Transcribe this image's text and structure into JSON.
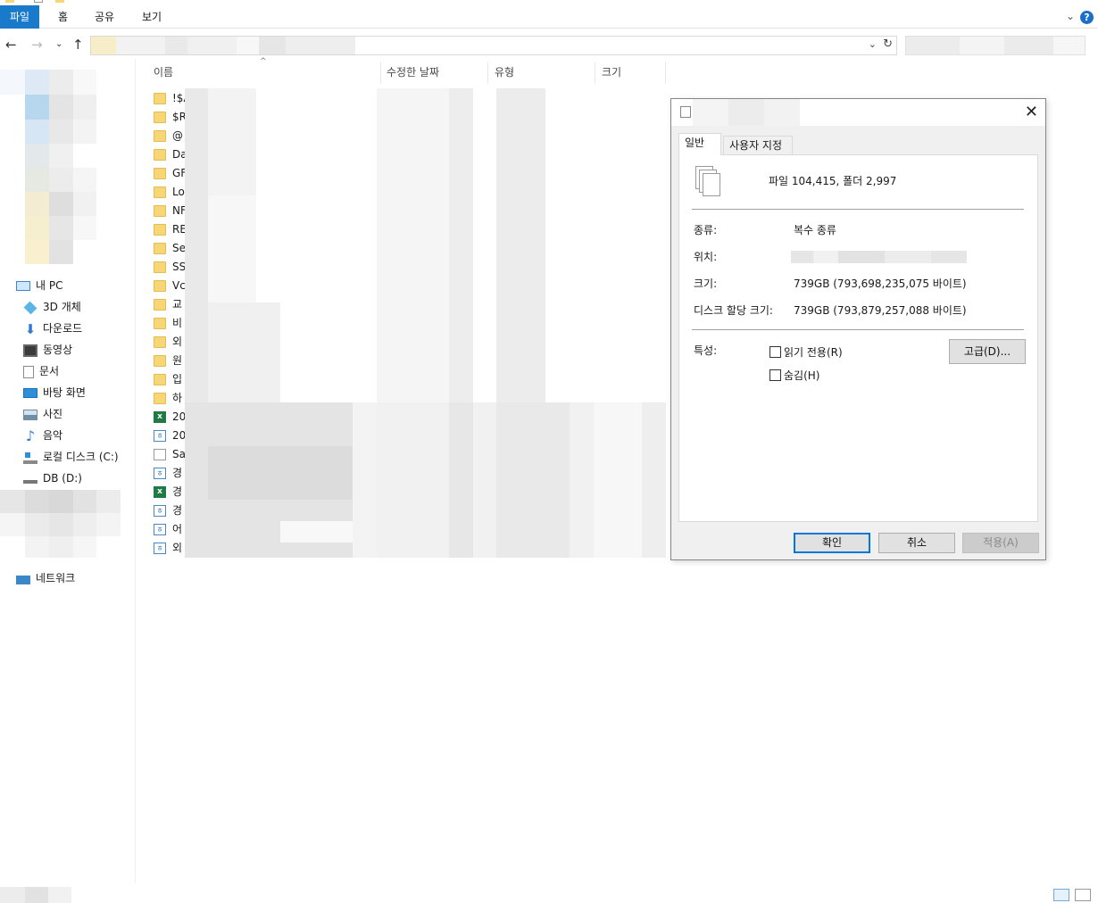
{
  "ribbon": {
    "tabs": [
      "파일",
      "홈",
      "공유",
      "보기"
    ],
    "help": "?"
  },
  "sidebar": {
    "this_pc": "내 PC",
    "items": [
      "3D 개체",
      "다운로드",
      "동영상",
      "문서",
      "바탕 화면",
      "사진",
      "음악",
      "로컬 디스크 (C:)",
      "DB (D:)"
    ],
    "network": "네트워크"
  },
  "file_list": {
    "columns": [
      "이름",
      "수정한 날짜",
      "유형",
      "크기"
    ],
    "rows": [
      {
        "icon": "folder",
        "name": "!$A"
      },
      {
        "icon": "folder",
        "name": "$R"
      },
      {
        "icon": "folder",
        "name": "@"
      },
      {
        "icon": "folder",
        "name": "Da"
      },
      {
        "icon": "folder",
        "name": "GF"
      },
      {
        "icon": "folder",
        "name": "Lo"
      },
      {
        "icon": "folder",
        "name": "NF"
      },
      {
        "icon": "folder",
        "name": "RE"
      },
      {
        "icon": "folder",
        "name": "Se"
      },
      {
        "icon": "folder",
        "name": "SS"
      },
      {
        "icon": "folder",
        "name": "Vc"
      },
      {
        "icon": "folder",
        "name": "교"
      },
      {
        "icon": "folder",
        "name": "비"
      },
      {
        "icon": "folder",
        "name": "외"
      },
      {
        "icon": "folder",
        "name": "원"
      },
      {
        "icon": "folder",
        "name": "입"
      },
      {
        "icon": "folder",
        "name": "하"
      },
      {
        "icon": "xlsx",
        "name": "20"
      },
      {
        "icon": "hwp",
        "name": "20"
      },
      {
        "icon": "txt",
        "name": "Sa"
      },
      {
        "icon": "hwp",
        "name": "경"
      },
      {
        "icon": "xlsx",
        "name": "경"
      },
      {
        "icon": "hwp",
        "name": "경"
      },
      {
        "icon": "hwp",
        "name": "어"
      },
      {
        "icon": "hwp",
        "name": "외"
      }
    ]
  },
  "dialog": {
    "close": "✕",
    "tabs": [
      "일반",
      "사용자 지정"
    ],
    "summary": "파일 104,415, 폴더 2,997",
    "props": [
      {
        "label": "종류:",
        "value": "복수 종류"
      },
      {
        "label": "위치:",
        "value": ""
      },
      {
        "label": "크기:",
        "value": "739GB (793,698,235,075 바이트)"
      },
      {
        "label": "디스크 할당 크기:",
        "value": "739GB (793,879,257,088 바이트)"
      }
    ],
    "attributes_label": "특성:",
    "readonly": "읽기 전용(R)",
    "hidden": "숨김(H)",
    "advanced": "고급(D)...",
    "ok": "확인",
    "cancel": "취소",
    "apply": "적용(A)"
  },
  "colors": {
    "file_tab": "#1979ca",
    "accent": "#0078d7"
  }
}
